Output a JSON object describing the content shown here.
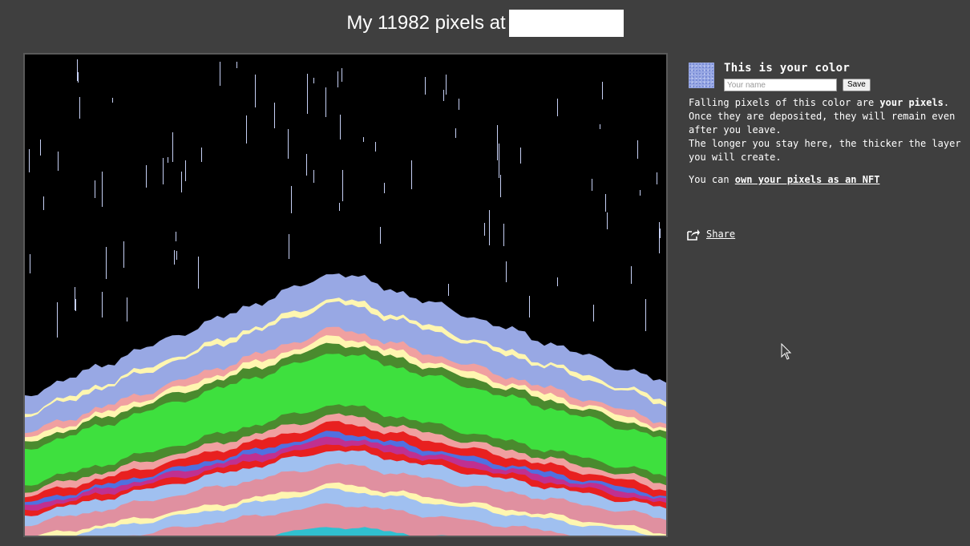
{
  "header": {
    "title": "My 11982 pixels at"
  },
  "colors": {
    "background": "#3f3f3f",
    "user_color": "#98a8e4",
    "canvas_background": "#000000"
  },
  "panel": {
    "heading": "This is your color",
    "name_input": {
      "placeholder": "Your name",
      "value": ""
    },
    "save_label": "Save",
    "line_1_pre": "Falling pixels of this color are ",
    "line_1_bold": "your pixels",
    "line_1_post": ".",
    "line_2": "Once they are deposited, they will remain even after you leave.",
    "line_3": "The longer you stay here, the thicker the layer you will create.",
    "nft_prefix": "You can ",
    "nft_link": "own your pixels as an NFT"
  },
  "share": {
    "icon": "share-icon",
    "label": "Share"
  },
  "canvas": {
    "layer_colors": [
      "#98a8e4",
      "#fff6b0",
      "#f0a0a0",
      "#4a8a2e",
      "#3ee03e",
      "#e82020",
      "#5070e0",
      "#c03090",
      "#a0c0f0",
      "#e090a0",
      "#30c0d0"
    ],
    "falling_color": "#c6d0f5"
  }
}
